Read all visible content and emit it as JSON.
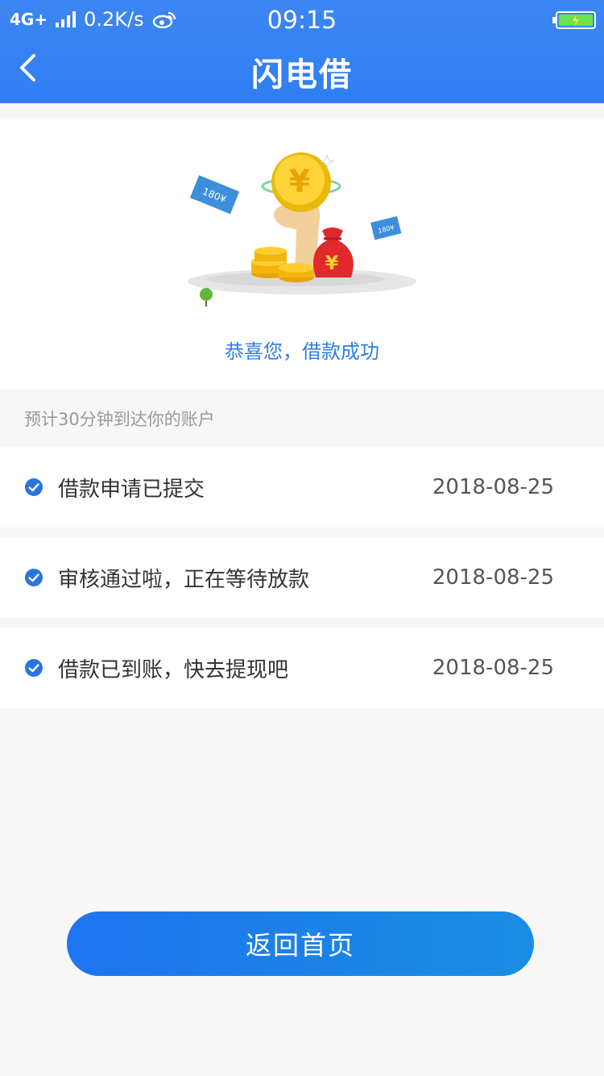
{
  "status_bar": {
    "network": "4G+",
    "speed": "0.2K/s",
    "time": "09:15"
  },
  "nav": {
    "title": "闪电借"
  },
  "illustration": {
    "bill_left_text": "180¥",
    "bill_right_text": "180¥",
    "coin_symbol": "¥",
    "bag_symbol": "¥"
  },
  "hero": {
    "success_text": "恭喜您，借款成功"
  },
  "eta_text": "预计30分钟到达你的账户",
  "steps": [
    {
      "label": "借款申请已提交",
      "date": "2018-08-25"
    },
    {
      "label": "审核通过啦，正在等待放款",
      "date": "2018-08-25"
    },
    {
      "label": "借款已到账，快去提现吧",
      "date": "2018-08-25"
    }
  ],
  "home_button": {
    "label": "返回首页"
  },
  "colors": {
    "primary": "#2f7ef2",
    "success_text": "#2d7de0",
    "check": "#2a74de"
  }
}
